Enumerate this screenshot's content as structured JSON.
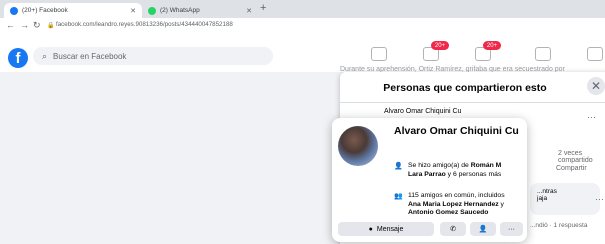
{
  "browser": {
    "tabs": [
      {
        "label": "(20+) Facebook",
        "active": true
      },
      {
        "label": "(2) WhatsApp",
        "active": false
      }
    ],
    "url": "facebook.com/leandro.reyes.90813236/posts/434440047852188"
  },
  "header": {
    "logo": "f",
    "search_placeholder": "Buscar en Facebook",
    "badges": [
      "20+",
      "20+"
    ]
  },
  "background_post_text": "Durante su aprehensión, Ortiz Ramírez, grifaba que era secuestrado por",
  "modal": {
    "title": "Personas que compartieron esto",
    "first_sharer": "Alvaro Omar Chiquini Cu",
    "share_count": "2 veces compartido",
    "share_button": "Compartir",
    "reply_preview": "...ntras\njaja",
    "reply_meta": "...ndió · 1 respuesta"
  },
  "hover_card": {
    "name": "Alvaro Omar Chiquini Cu",
    "friend_prefix": "Se hizo amigo(a) de ",
    "friend_name": "Román M Lara Parrao",
    "friend_suffix": " y 6 personas más",
    "mutual_prefix": "115 amigos en común, incluidos ",
    "mutual_name1": "Ana Maria Lopez Hernandez",
    "mutual_mid": " y ",
    "mutual_name2": "Antonio Gomez Saucedo",
    "actions": {
      "message": "Mensaje",
      "more": "···"
    }
  }
}
